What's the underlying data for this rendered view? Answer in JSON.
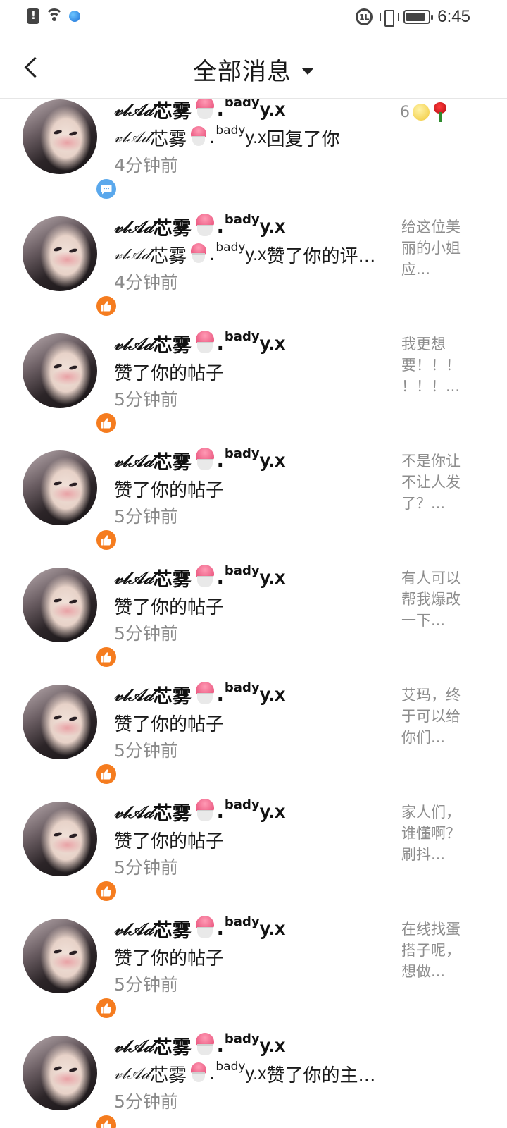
{
  "status_bar": {
    "time": "6:45",
    "sync_label": "1L"
  },
  "header": {
    "title": "全部消息"
  },
  "sender": {
    "prefix": "𝓋𝓁𝒜𝒹",
    "name": "芯雾",
    "sup": "bady",
    "tail": "y.x"
  },
  "messages": [
    {
      "type": "reply",
      "icon": "chat-bubble-icon",
      "action": "回复了你",
      "show_sender_in_desc": true,
      "time": "4分钟前",
      "preview_text": "6",
      "preview_is_emoji": true
    },
    {
      "type": "like",
      "icon": "thumbs-up-icon",
      "action": "赞了你的评...",
      "show_sender_in_desc": true,
      "time": "4分钟前",
      "preview": "给这位美\n丽的小姐\n应..."
    },
    {
      "type": "like",
      "icon": "thumbs-up-icon",
      "action": "赞了你的帖子",
      "show_sender_in_desc": false,
      "time": "5分钟前",
      "preview": "我更想\n要！！！\n！！！..."
    },
    {
      "type": "like",
      "icon": "thumbs-up-icon",
      "action": "赞了你的帖子",
      "show_sender_in_desc": false,
      "time": "5分钟前",
      "preview": "不是你让\n不让人发\n了？..."
    },
    {
      "type": "like",
      "icon": "thumbs-up-icon",
      "action": "赞了你的帖子",
      "show_sender_in_desc": false,
      "time": "5分钟前",
      "preview": "有人可以\n帮我爆改\n一下..."
    },
    {
      "type": "like",
      "icon": "thumbs-up-icon",
      "action": "赞了你的帖子",
      "show_sender_in_desc": false,
      "time": "5分钟前",
      "preview": "艾玛，终\n于可以给\n你们..."
    },
    {
      "type": "like",
      "icon": "thumbs-up-icon",
      "action": "赞了你的帖子",
      "show_sender_in_desc": false,
      "time": "5分钟前",
      "preview": "家人们，\n谁懂啊？\n刷抖..."
    },
    {
      "type": "like",
      "icon": "thumbs-up-icon",
      "action": "赞了你的帖子",
      "show_sender_in_desc": false,
      "time": "5分钟前",
      "preview": "在线找蛋\n搭子呢，\n想做..."
    },
    {
      "type": "like",
      "icon": "thumbs-up-icon",
      "action": "赞了你的主...",
      "show_sender_in_desc": true,
      "time": "5分钟前",
      "preview": ""
    }
  ],
  "colors": {
    "like_badge": "#f57c1f",
    "reply_badge": "#5aa8ec",
    "muted_text": "#8a8a8a"
  }
}
